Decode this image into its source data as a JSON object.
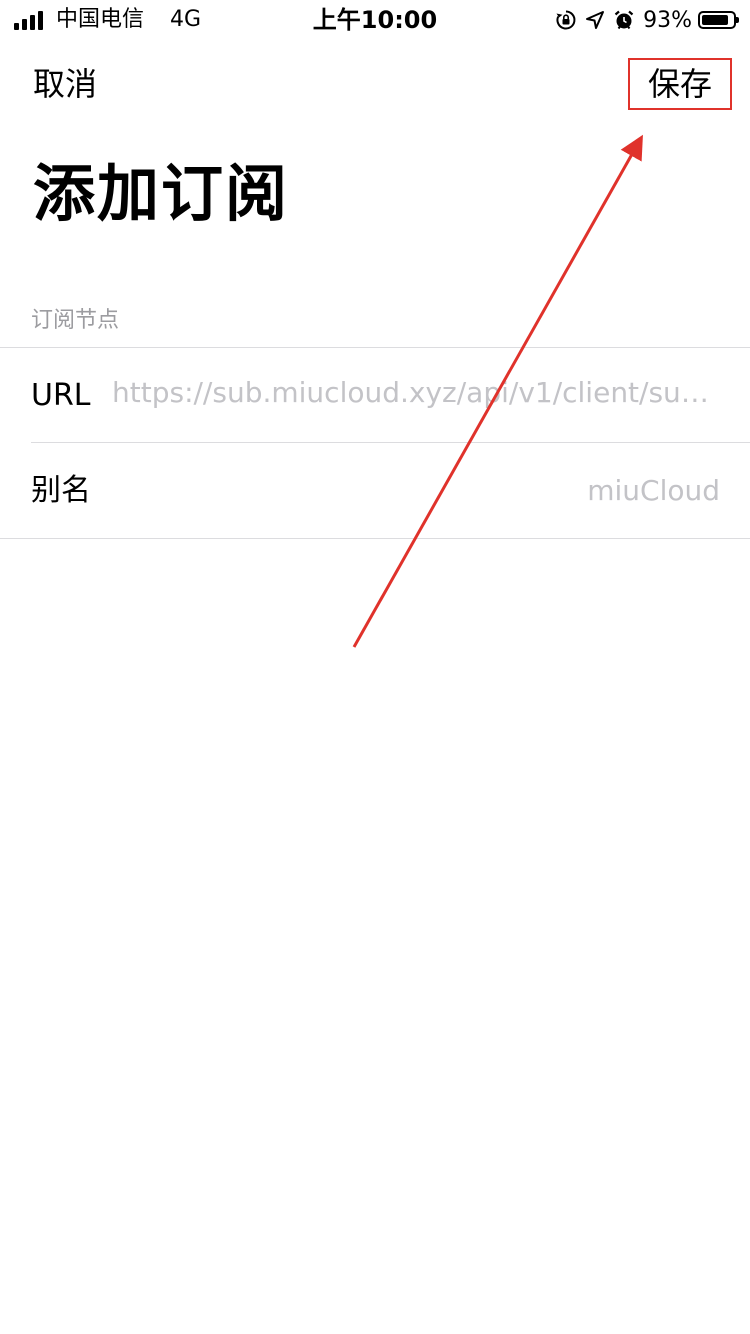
{
  "status_bar": {
    "carrier": "中国电信",
    "network": "4G",
    "time": "上午10:00",
    "battery_percent": "93%",
    "battery_level": 0.93,
    "icons": [
      "signal-icon",
      "rotation-lock-icon",
      "location-icon",
      "alarm-icon",
      "battery-icon"
    ]
  },
  "nav": {
    "cancel_label": "取消",
    "save_label": "保存",
    "highlight_color": "#e0322b"
  },
  "page": {
    "title": "添加订阅"
  },
  "section": {
    "header": "订阅节点",
    "rows": [
      {
        "label": "URL",
        "value": "https://sub.miucloud.xyz/api/v1/client/subs..."
      },
      {
        "label": "别名",
        "value": "miuCloud"
      }
    ]
  },
  "annotation": {
    "type": "red-arrow",
    "color": "#e0322b"
  }
}
